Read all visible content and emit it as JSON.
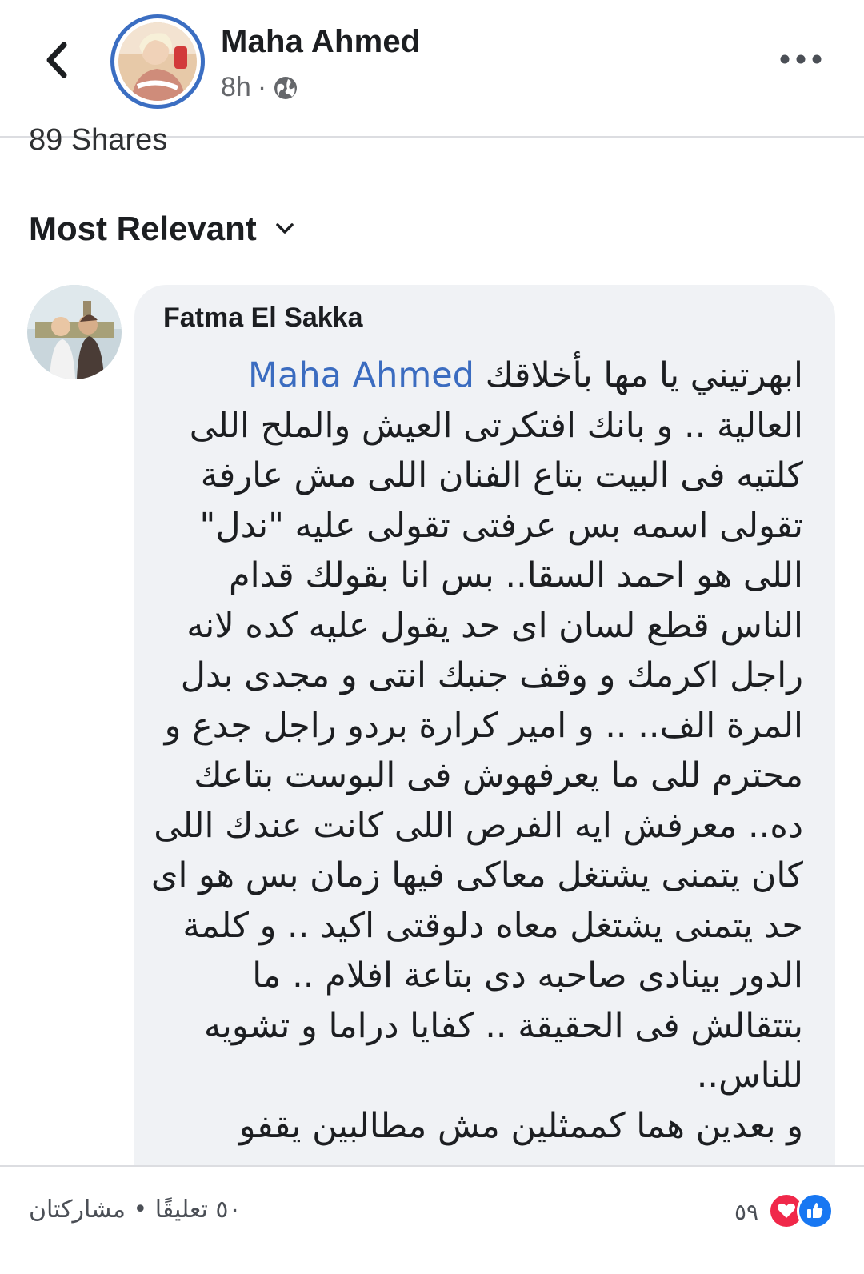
{
  "header": {
    "poster_name": "Maha Ahmed",
    "time": "8h",
    "separator": "·",
    "back_icon": "chevron-left-icon",
    "privacy_icon": "globe-icon",
    "more_label": "•••"
  },
  "shares_partial": "89 Shares",
  "sort": {
    "label": "Most Relevant",
    "icon": "chevron-down-icon"
  },
  "comment": {
    "author": "Fatma El Sakka",
    "mention": "Maha Ahmed",
    "lines": [
      "ابهرتيني يا مها بأخلاقك",
      "العالية .. و بانك افتكرتى العيش والملح اللى",
      "كلتيه فى البيت بتاع الفنان اللى مش عارفة",
      "تقولى اسمه بس عرفتى تقولى عليه \"ندل\"",
      "اللى هو احمد السقا.. بس انا بقولك قدام",
      "الناس قطع لسان اى حد يقول عليه كده لانه",
      "راجل اكرمك و وقف جنبك انتى و مجدى بدل",
      "المرة الف.. .. و امير كرارة بردو راجل جدع و",
      "محترم للى ما يعرفهوش فى البوست بتاعك",
      "ده.. معرفش ايه الفرص اللى كانت عندك اللى",
      "كان يتمنى يشتغل معاكى فيها زمان بس هو اى",
      "حد يتمنى يشتغل معاه دلوقتى اكيد .. و كلمة",
      "الدور بينادى صاحبه دى بتاعة افلام .. ما",
      "بتتقالش فى الحقيقة .. كفايا دراما و تشويه",
      "للناس..",
      "و بعدين هما كممثلين مش مطالبين يقفو"
    ]
  },
  "footer": {
    "reaction_count": "٥٩",
    "comments_shares": "٥٠ تعليقًا • مشاركتان",
    "reactions": [
      "like-icon",
      "love-icon"
    ]
  },
  "colors": {
    "mention": "#3b6cc0",
    "bubble": "#f0f2f5",
    "avatar_ring": "#3b6ec2",
    "like": "#1877f2",
    "love": "#f0284a"
  }
}
